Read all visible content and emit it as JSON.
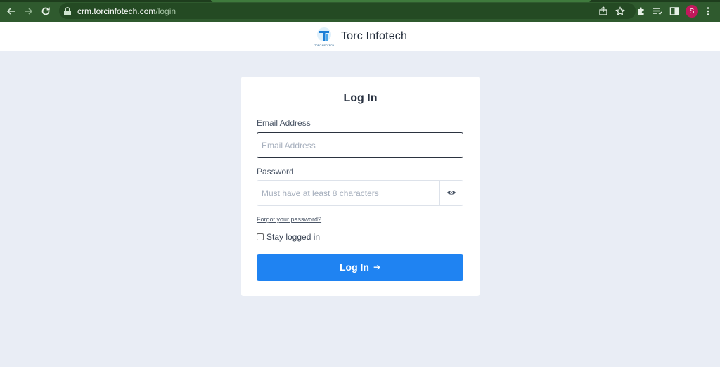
{
  "browser": {
    "url_host": "crm.torcinfotech.com",
    "url_path": "/login",
    "profile_initial": "S"
  },
  "header": {
    "brand_name": "Torc Infotech",
    "logo_text": "TORC INFOTECH"
  },
  "login": {
    "title": "Log In",
    "email_label": "Email Address",
    "email_placeholder": "Email Address",
    "password_label": "Password",
    "password_placeholder": "Must have at least 8 characters",
    "forgot_link": "Forgot your password?",
    "stay_logged_in_label": "Stay logged in",
    "stay_logged_in_checked": false,
    "submit_label": "Log In",
    "submit_arrow": "➔"
  },
  "colors": {
    "chrome": "#2f5a2e",
    "page_bg": "#e9edf5",
    "accent": "#1f83f2"
  }
}
